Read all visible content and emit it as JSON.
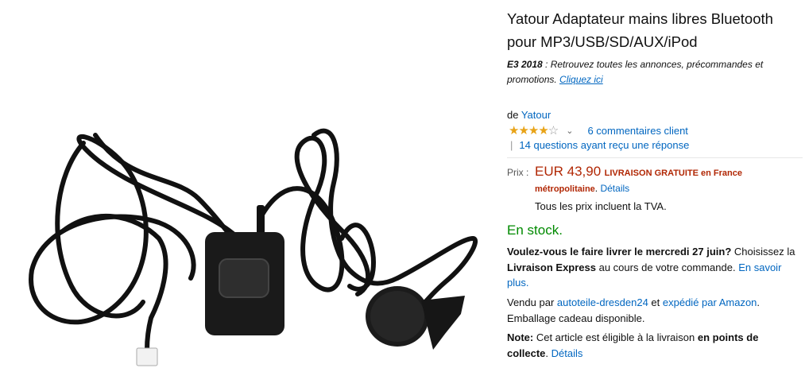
{
  "product": {
    "title": "Yatour Adaptateur mains libres Bluetooth pour MP3/USB/SD/AUX/iPod",
    "image_icon": "product-photo-bluetooth-adapter"
  },
  "promo": {
    "event": "E3 2018",
    "text": " : Retrouvez toutes les annonces, précommandes et promotions. ",
    "link": "Cliquez ici"
  },
  "brand": {
    "prefix": "de ",
    "name": "Yatour"
  },
  "rating": {
    "stars_value": 4,
    "stars_max": 5,
    "reviews_link": "6 commentaires client",
    "questions_link": "14 questions ayant reçu une réponse"
  },
  "price": {
    "label": "Prix :",
    "amount": "EUR 43,90",
    "shipping": "LIVRAISON GRATUITE en France métropolitaine",
    "details_link": "Détails",
    "vat": "Tous les prix incluent la TVA."
  },
  "stock": "En stock.",
  "delivery": {
    "part1": "Voulez-vous le faire livrer le mercredi 27 juin?",
    "part2": " Choisissez la ",
    "part3": "Livraison Express",
    "part4": " au cours de votre commande. ",
    "learn_more": "En savoir plus."
  },
  "seller": {
    "sold_by": "Vendu par ",
    "seller_name": "autoteile-dresden24",
    "and": " et ",
    "shipped_by": "expédié par Amazon",
    "dot": ".",
    "gift_wrap": "Emballage cadeau disponible."
  },
  "note": {
    "label": "Note:",
    "text": " Cet article est éligible à la livraison ",
    "bold": "en points de collecte",
    "dot": ". ",
    "link": "Détails"
  },
  "colors": {
    "link": "#0066c0",
    "price": "#b12704",
    "in_stock": "#008a00",
    "star": "#e8a317"
  }
}
